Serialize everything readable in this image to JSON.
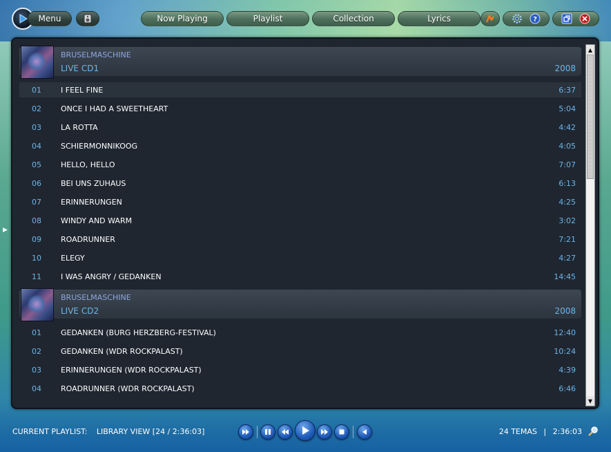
{
  "top_bar": {
    "menu_label": "Menu",
    "tabs": [
      {
        "label": "Now Playing"
      },
      {
        "label": "Playlist"
      },
      {
        "label": "Collection"
      },
      {
        "label": "Lyrics"
      }
    ]
  },
  "playlist": {
    "albums": [
      {
        "artist": "BRUSELMASCHINE",
        "album": "LIVE CD1",
        "year": "2008",
        "tracks": [
          {
            "num": "01",
            "title": "I FEEL FINE",
            "duration": "6:37"
          },
          {
            "num": "02",
            "title": "ONCE I HAD A SWEETHEART",
            "duration": "5:04"
          },
          {
            "num": "03",
            "title": "LA ROTTA",
            "duration": "4:42"
          },
          {
            "num": "04",
            "title": "SCHIERMONNIKOOG",
            "duration": "4:05"
          },
          {
            "num": "05",
            "title": "HELLO, HELLO",
            "duration": "7:07"
          },
          {
            "num": "06",
            "title": "BEI UNS ZUHAUS",
            "duration": "6:13"
          },
          {
            "num": "07",
            "title": "ERINNERUNGEN",
            "duration": "4:25"
          },
          {
            "num": "08",
            "title": "WINDY AND WARM",
            "duration": "3:02"
          },
          {
            "num": "09",
            "title": "ROADRUNNER",
            "duration": "7:21"
          },
          {
            "num": "10",
            "title": "ELEGY",
            "duration": "4:27"
          },
          {
            "num": "11",
            "title": "I WAS ANGRY / GEDANKEN",
            "duration": "14:45"
          }
        ]
      },
      {
        "artist": "BRUSELMASCHINE",
        "album": "LIVE CD2",
        "year": "2008",
        "tracks": [
          {
            "num": "01",
            "title": "GEDANKEN (BURG HERZBERG-FESTIVAL)",
            "duration": "12:40"
          },
          {
            "num": "02",
            "title": "GEDANKEN (WDR ROCKPALAST)",
            "duration": "10:24"
          },
          {
            "num": "03",
            "title": "ERINNERUNGEN (WDR ROCKPALAST)",
            "duration": "4:39"
          },
          {
            "num": "04",
            "title": "ROADRUNNER (WDR ROCKPALAST)",
            "duration": "6:46"
          }
        ]
      }
    ]
  },
  "status": {
    "current_playlist_label": "CURRENT PLAYLIST:",
    "view_info": "LIBRARY VIEW [24 / 2:36:03]",
    "track_count": "24 TEMAS",
    "separator": "|",
    "total_duration": "2:36:03"
  },
  "colors": {
    "panel_bg": "#1f2630",
    "accent_blue": "#6fb5e6",
    "artist_color": "#8fa6e0"
  },
  "icons": {
    "logo": "play-logo-icon",
    "mini_player": "speaker-icon",
    "lastfm": "lastfm-icon",
    "settings": "gear-icon",
    "help": "help-icon",
    "restore": "restore-window-icon",
    "close": "close-icon",
    "search": "magnifier-icon"
  }
}
